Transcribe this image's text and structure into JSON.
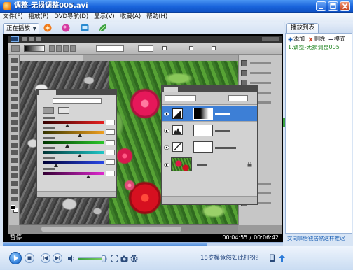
{
  "window": {
    "title": "调整-无损调整005.avi"
  },
  "menu": [
    {
      "label": "文件(F)"
    },
    {
      "label": "播放(P)"
    },
    {
      "label": "DVD导航(D)"
    },
    {
      "label": "显示(V)"
    },
    {
      "label": "收藏(A)"
    },
    {
      "label": "帮助(H)"
    }
  ],
  "toolbar": {
    "now_playing_tab": "正在播放",
    "icons": [
      "burst-icon",
      "ball-icon",
      "screen-icon",
      "leaf-icon"
    ]
  },
  "video": {
    "status": "暂停",
    "time_current": "00:04:55",
    "time_separator": "/",
    "time_total": "00:06:42",
    "progress": 0.73
  },
  "playlist": {
    "title": "播放列表",
    "actions": [
      {
        "icon": "plus-icon",
        "label": "添加"
      },
      {
        "icon": "delete-icon",
        "label": "删除"
      },
      {
        "icon": "mode-icon",
        "label": "模式"
      }
    ],
    "items": [
      {
        "label": "1.调整-无损调整005"
      }
    ],
    "promo_text": "女同事借钱居然这样推迟"
  },
  "controls": {
    "buttons": [
      "play-icon",
      "stop-icon",
      "previous-icon",
      "next-icon",
      "volume-icon"
    ],
    "volume": 0.9,
    "tools": [
      "fullscreen-icon",
      "capture-icon",
      "settings-icon"
    ],
    "promo_text": "18岁模竟然如此打扮？",
    "extra_icons": [
      "mobile-icon",
      "upload-icon"
    ]
  },
  "colors": {
    "title_bar": "#1a64dc",
    "video_background": "#000000",
    "playlist_item": "#2a8a2a",
    "promo_link": "#1a5fb4",
    "selected_layer": "#3d7fd6",
    "volume_fill": "#3aa040"
  }
}
